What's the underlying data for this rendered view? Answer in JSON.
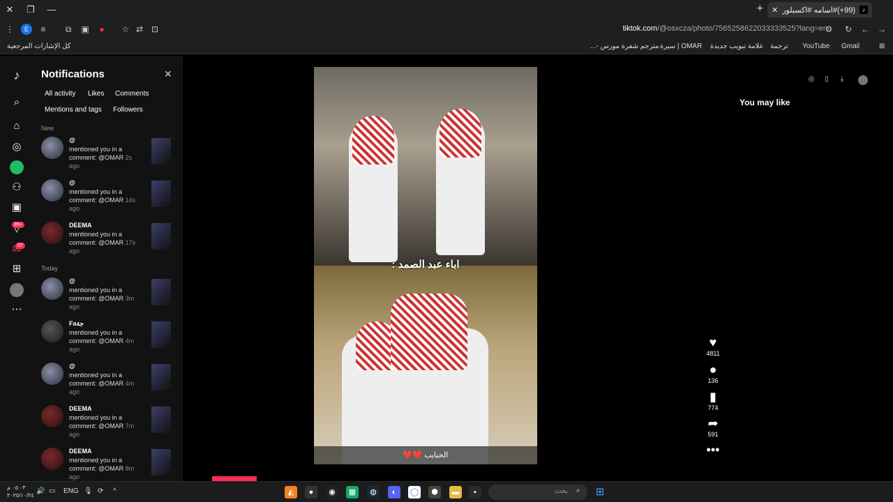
{
  "browser": {
    "tab_title": "(99+)#اسامه #اكسبلور #ترند #...",
    "tab_icon": "tiktok-icon",
    "url_domain": "tiktok.com",
    "url_path": "/@osxcza/photo/7565258622033333525?lang=en",
    "bookmarks": [
      "Gmail",
      "YouTube",
      "ترجمة",
      "علامة تبويب جديدة",
      "OMAR | سيرة",
      "مترجم شفرة مورس -...",
      "كل الإشارات المرجعية"
    ]
  },
  "nav": {
    "badge_inbox": "99+",
    "badge_messages": "37"
  },
  "notifications": {
    "title": "Notifications",
    "filters": [
      "All activity",
      "Likes",
      "Comments",
      "Mentions and tags",
      "Followers"
    ],
    "sections": {
      "new": "New",
      "today": "Today"
    },
    "items": [
      {
        "name": "@",
        "text": "mentioned you in a comment: @OMAR",
        "ago": "2s ago",
        "avatar": "blue"
      },
      {
        "name": "@",
        "text": "mentioned you in a comment: @OMAR",
        "ago": "14s ago",
        "avatar": "blue"
      },
      {
        "name": "DEEMA",
        "text": "mentioned you in a comment: @OMAR",
        "ago": "17s ago",
        "avatar": "red"
      },
      {
        "name": "@",
        "text": "mentioned you in a comment: @OMAR",
        "ago": "3m ago",
        "avatar": "blue"
      },
      {
        "name": "Faجة",
        "text": "mentioned you in a comment: @OMAR",
        "ago": "4m ago",
        "avatar": "dark"
      },
      {
        "name": "@",
        "text": "mentioned you in a comment: @OMAR",
        "ago": "4m ago",
        "avatar": "blue"
      },
      {
        "name": "DEEMA",
        "text": "mentioned you in a comment: @OMAR",
        "ago": "7m ago",
        "avatar": "red"
      },
      {
        "name": "DEEMA",
        "text": "mentioned you in a comment: @OMAR",
        "ago": "8m ago",
        "avatar": "red"
      }
    ]
  },
  "post": {
    "overlay_text": "اباء عبد الصمد :",
    "caption": "الحبايب ❤️❤️",
    "likes": "4811",
    "comments": "136",
    "saves": "774",
    "shares": "591"
  },
  "sidebar": {
    "heading": "You may like"
  },
  "taskbar": {
    "search_placeholder": "بحث",
    "lang": "ENG",
    "time": "٠٥:٠٣ م",
    "date": "٢٠٢٥/١٠/٢٤"
  },
  "colors": {
    "accent": "#fe2c55",
    "background": "#000000",
    "panel": "#121212"
  }
}
